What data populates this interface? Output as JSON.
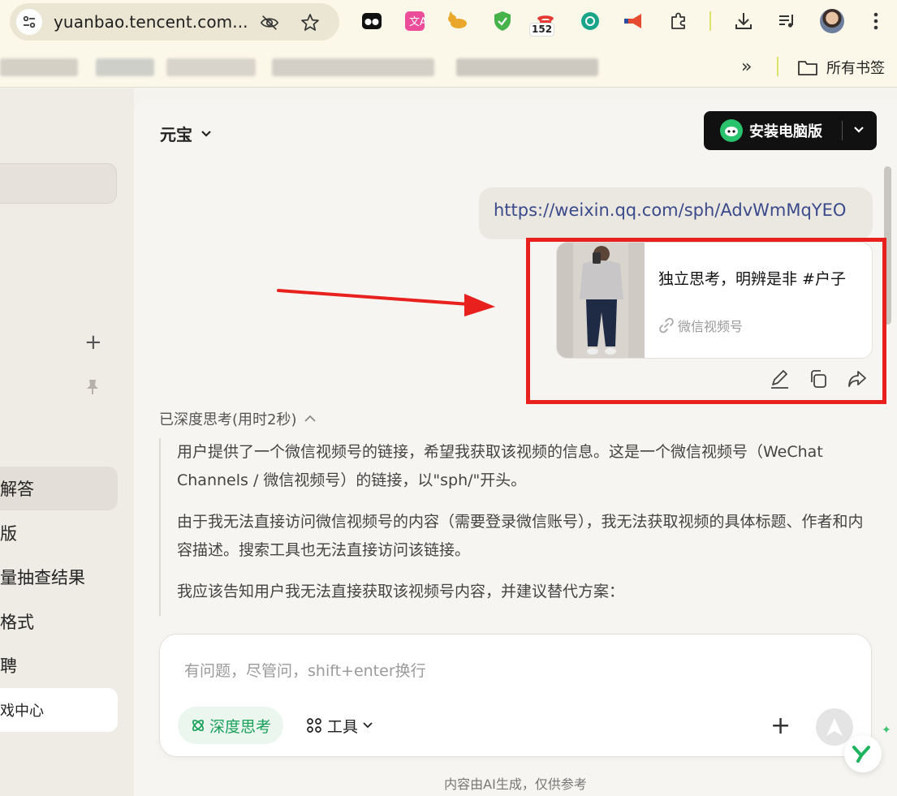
{
  "browser": {
    "url": "yuanbao.tencent.com...",
    "extension_badge": "152",
    "bookmarks_folder_label": "所有书签",
    "bookmarks_overflow": "»"
  },
  "sidebar": {
    "items": [
      "解答",
      "版",
      "量抽查结果",
      "格式",
      "聘",
      "戏中心"
    ]
  },
  "header": {
    "model_name": "元宝",
    "install_label": "安装电脑版"
  },
  "chat": {
    "user_link": "https://weixin.qq.com/sph/AdvWmMqYEO",
    "card_title": "独立思考，明辨是非 #户子",
    "card_source": "微信视频号",
    "thinking_header": "已深度思考(用时2秒)",
    "thinking_paragraphs": [
      "用户提供了一个微信视频号的链接，希望我获取该视频的信息。这是一个微信视频号（WeChat Channels / 微信视频号）的链接，以\"sph/\"开头。",
      "由于我无法直接访问微信视频号的内容（需要登录微信账号），我无法获取视频的具体标题、作者和内容描述。搜索工具也无法直接访问该链接。",
      "我应该告知用户我无法直接获取该视频号内容，并建议替代方案："
    ]
  },
  "composer": {
    "placeholder": "有问题，尽管问，shift+enter换行",
    "deep_think_label": "深度思考",
    "tools_label": "工具"
  },
  "footer": {
    "disclaimer": "内容由AI生成，仅供参考"
  },
  "colors": {
    "accent_green": "#19a05b",
    "annotation_red": "#e8211e",
    "link_blue": "#3a4a8a"
  }
}
